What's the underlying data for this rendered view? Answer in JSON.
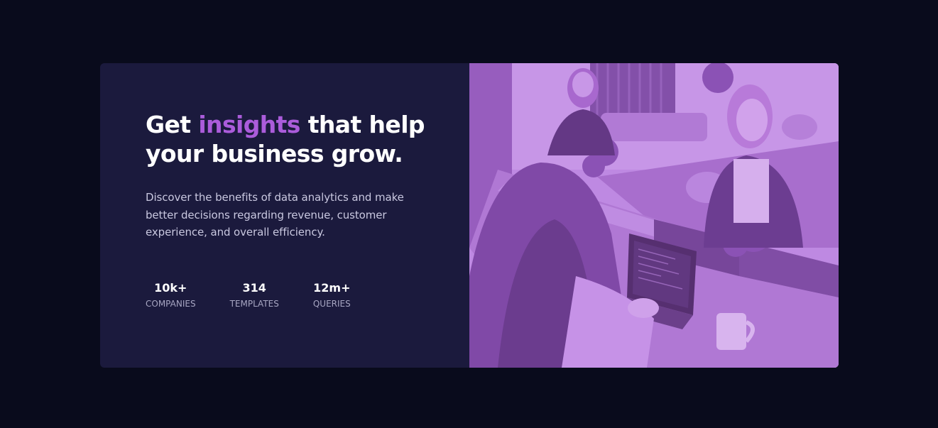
{
  "hero": {
    "headline_before": "Get ",
    "headline_accent": "insights",
    "headline_after": " that help your business grow.",
    "description": "Discover the benefits of data analytics and make better decisions regarding revenue, customer experience, and overall efficiency.",
    "accent_color": "#ab5cdb",
    "image_tint_color": "#aa5cdb"
  },
  "stats": [
    {
      "value": "10k+",
      "label": "COMPANIES"
    },
    {
      "value": "314",
      "label": "TEMPLATES"
    },
    {
      "value": "12m+",
      "label": "QUERIES"
    }
  ]
}
